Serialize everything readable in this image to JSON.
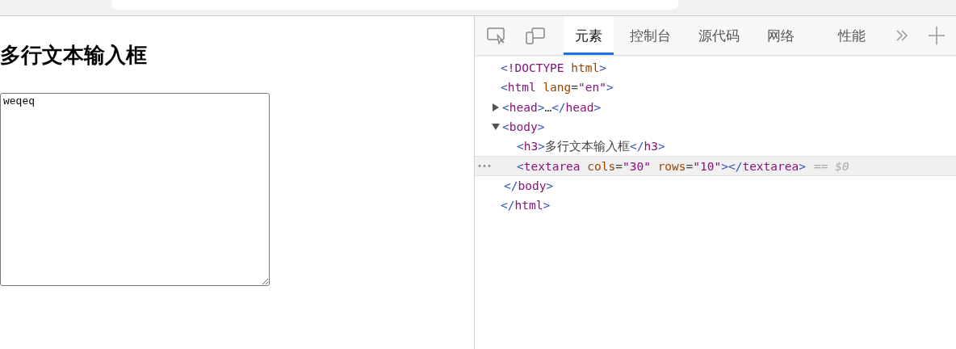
{
  "page": {
    "heading": "多行文本输入框",
    "textarea": {
      "value": "weqeq"
    }
  },
  "devtools": {
    "tabs": [
      {
        "label": "元素",
        "selected": true
      },
      {
        "label": "控制台",
        "selected": false
      },
      {
        "label": "源代码",
        "selected": false
      },
      {
        "label": "网络",
        "selected": false
      },
      {
        "label": "性能",
        "selected": false
      }
    ],
    "dom_tree": [
      {
        "markup": "<!DOCTYPE html>",
        "selected": false
      },
      {
        "markup": "<html lang=\"en\">",
        "selected": false,
        "closing": "</html>",
        "children": [
          {
            "markup": "<head>…</head>",
            "selected": false,
            "expanded": false
          },
          {
            "markup": "<body>",
            "selected": false,
            "expanded": true,
            "closing": "</body>",
            "children": [
              {
                "markup": "<h3>多行文本输入框</h3>",
                "selected": false
              },
              {
                "markup": "<textarea cols=\"30\" rows=\"10\"></textarea>",
                "selected": true,
                "suffix": "== $0"
              }
            ]
          }
        ]
      }
    ]
  }
}
